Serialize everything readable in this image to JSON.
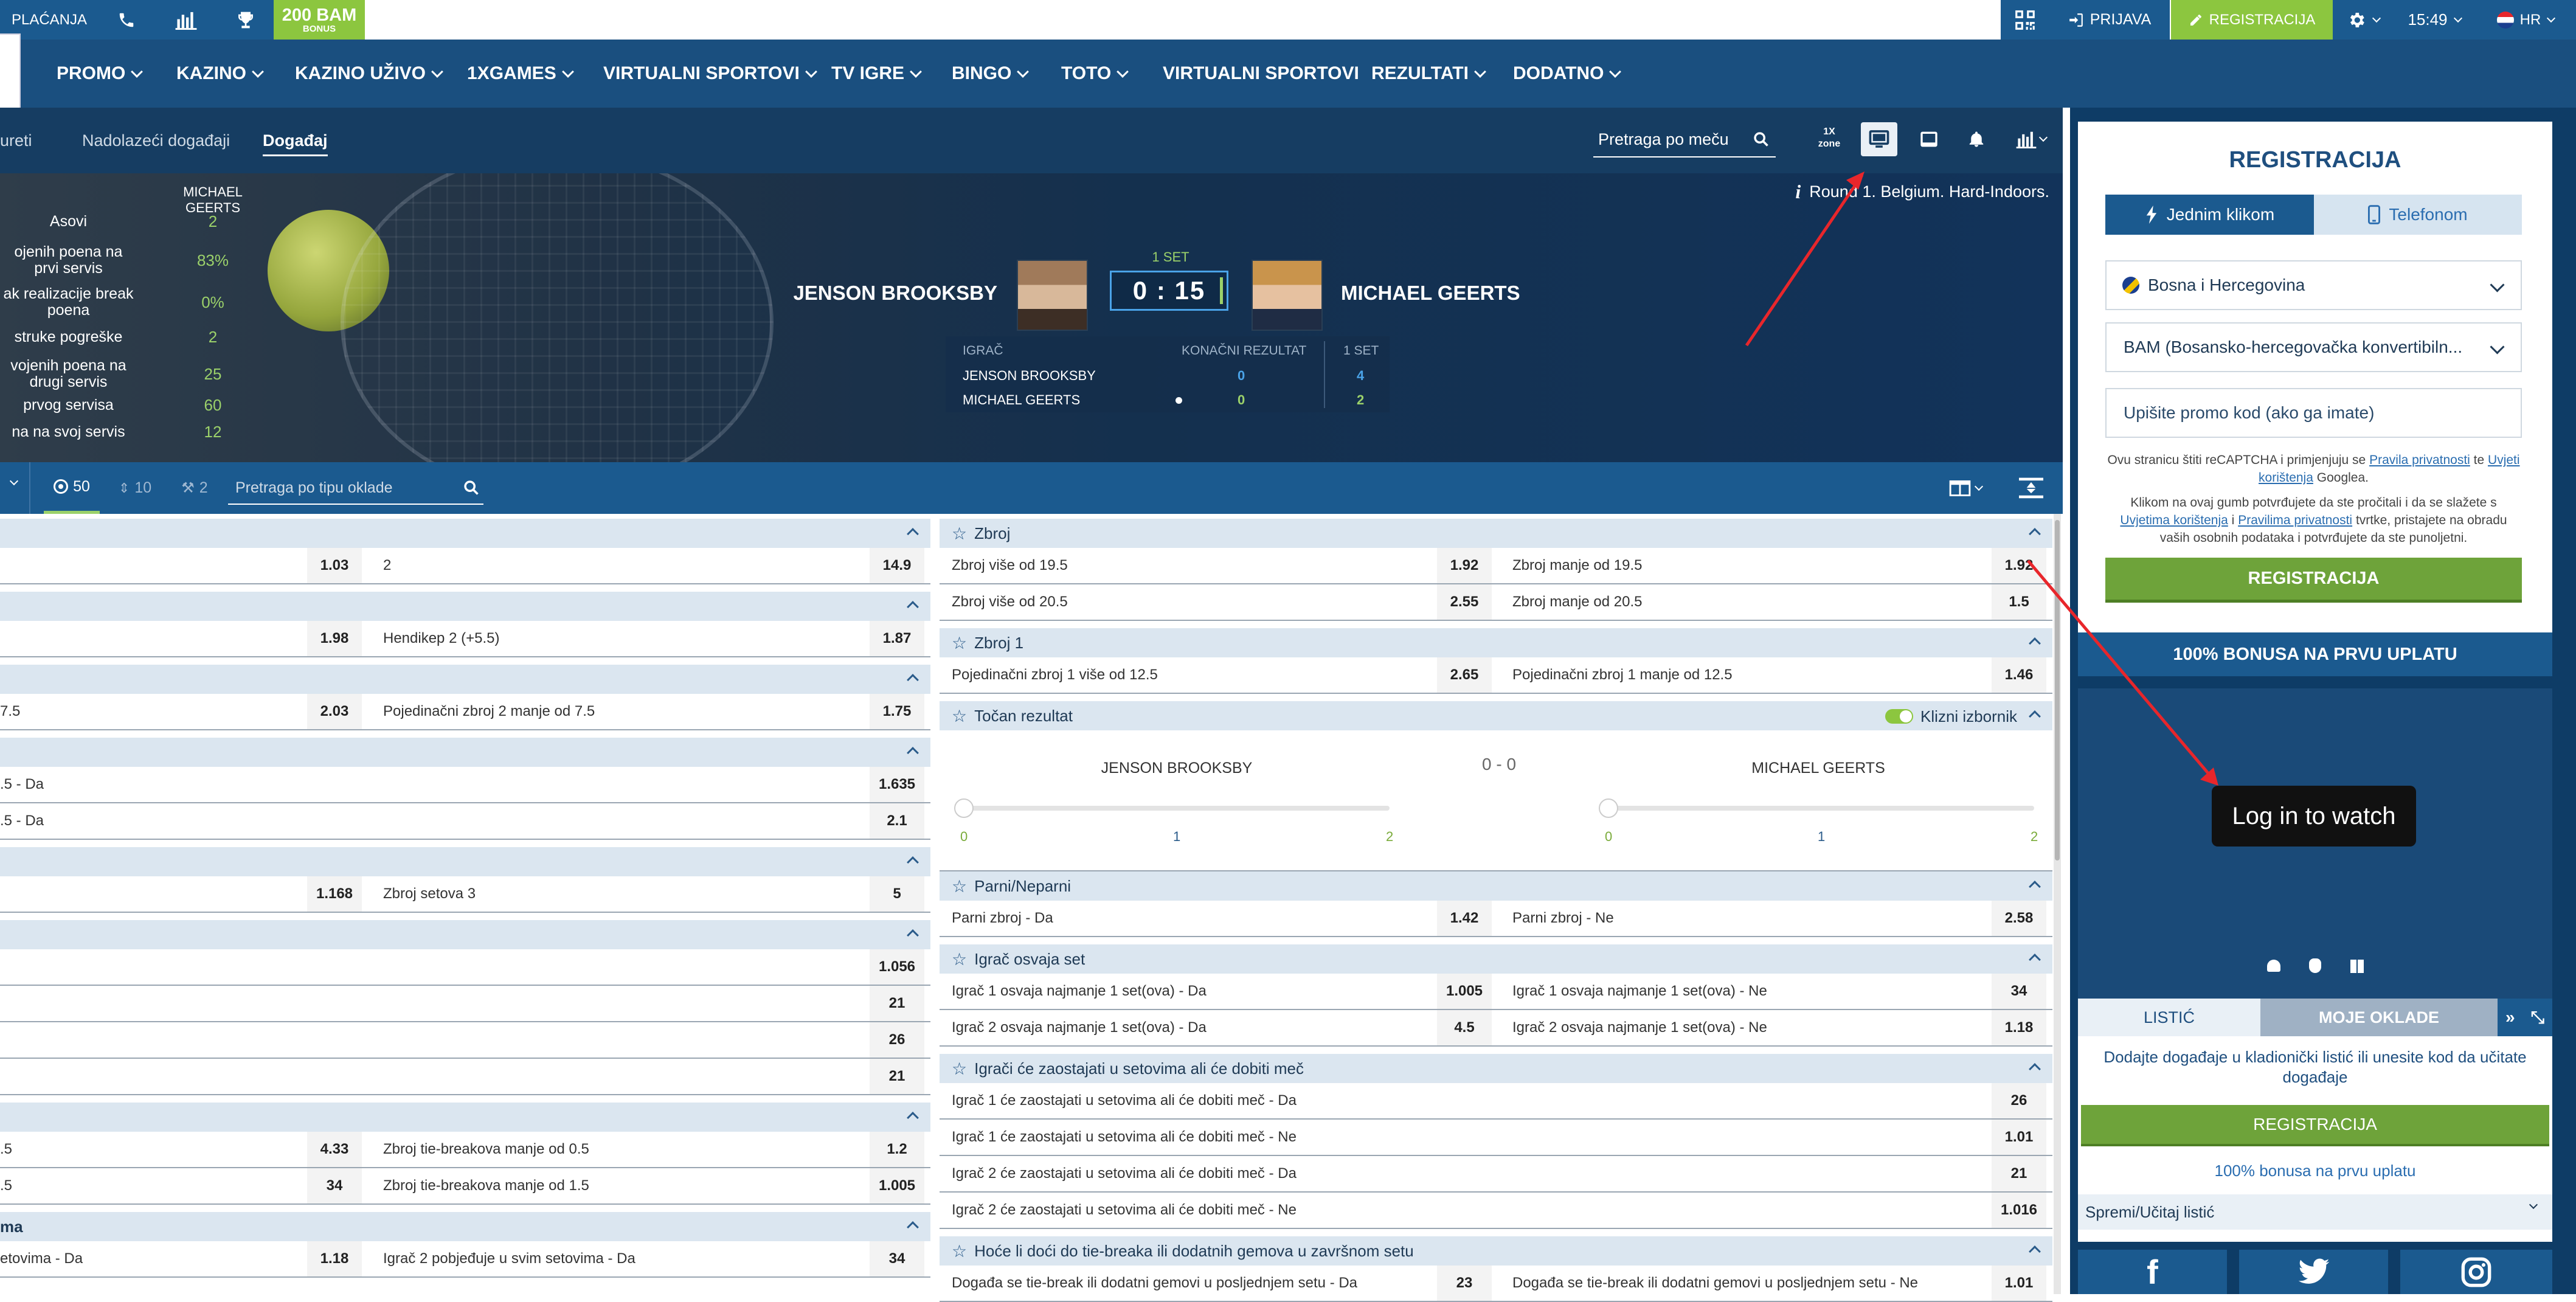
{
  "topbar": {
    "deposit_label": "PLAĆANJA",
    "bonus_amount": "200 BAM",
    "bonus_label": "BONUS",
    "login_label": "PRIJAVA",
    "register_label": "REGISTRACIJA",
    "time": "15:49",
    "language": "HR"
  },
  "menu": {
    "items": [
      "PROMO",
      "KAZINO",
      "KAZINO UŽIVO",
      "1XGAMES",
      "VIRTUALNI SPORTOVI",
      "TV IGRE",
      "BINGO",
      "TOTO",
      "VIRTUALNI SPORTOVI",
      "REZULTATI",
      "DODATNO"
    ]
  },
  "subnav": {
    "tab_1": "ureti",
    "tab_2": "Nadolazeći događaji",
    "tab_3": "Događaj",
    "search_placeholder": "Pretraga po meču",
    "zone_label": "1X zone"
  },
  "event": {
    "info": "Round 1. Belgium. Hard-Indoors.",
    "stats_header": "MICHAEL GEERTS",
    "stats": [
      {
        "label": "Asovi",
        "value": "2"
      },
      {
        "label": "ojenih poena na prvi servis",
        "value": "83%"
      },
      {
        "label": "ak realizacije break poena",
        "value": "0%"
      },
      {
        "label": "struke pogreške",
        "value": "2"
      },
      {
        "label": "vojenih poena na drugi servis",
        "value": "25"
      },
      {
        "label": "prvog servisa",
        "value": "60"
      },
      {
        "label": "na na svoj servis",
        "value": "12"
      }
    ],
    "player1": "JENSON BROOKSBY",
    "player2": "MICHAEL GEERTS",
    "set_label": "1 SET",
    "score": "0 : 15",
    "table_headers": {
      "player": "IGRAČ",
      "final": "KONAČNI REZULTAT",
      "set": "1 SET"
    },
    "table_rows": [
      {
        "name": "JENSON BROOKSBY",
        "final": "0",
        "set": "4"
      },
      {
        "name": "MICHAEL GEERTS",
        "final": "0",
        "set": "2"
      }
    ]
  },
  "toolbar": {
    "count_all": "50",
    "count_2": "10",
    "count_3": "2",
    "search_placeholder": "Pretraga po tipu oklade"
  },
  "left_markets": {
    "r1_odd1": "1.03",
    "r1_label2": "2",
    "r1_odd2": "14.9",
    "r2_odd1": "1.98",
    "r2_label2": "Hendikep 2 (+5.5)",
    "r2_odd2": "1.87",
    "r3_label1": "7.5",
    "r3_odd1": "2.03",
    "r3_label2": "Pojedinačni zbroj 2 manje od 7.5",
    "r3_odd2": "1.75",
    "r4_label1": ".5 - Da",
    "r4_odd": "1.635",
    "r5_label1": ".5 - Da",
    "r5_odd": "2.1",
    "r6_odd1": "1.168",
    "r6_label2": "Zbroj setova 3",
    "r6_odd2": "5",
    "r7_odd": "1.056",
    "r8_odd": "21",
    "r9_odd": "26",
    "r10_odd": "21",
    "r11_label1": ".5",
    "r11_odd1": "4.33",
    "r11_label2": "Zbroj tie-breakova manje od 0.5",
    "r11_odd2": "1.2",
    "r12_label1": ".5",
    "r12_odd1": "34",
    "r12_label2": "Zbroj tie-breakova manje od 1.5",
    "r12_odd2": "1.005",
    "sec_ma": "ma",
    "r13_label1": "etovima - Da",
    "r13_odd1": "1.18",
    "r13_label2": "Igrač 2 pobjeđuje u svim setovima - Da",
    "r13_odd2": "34"
  },
  "right_markets": {
    "zbroj": {
      "title": "Zbroj",
      "rows": [
        {
          "l1": "Zbroj više od 19.5",
          "o1": "1.92",
          "l2": "Zbroj manje od 19.5",
          "o2": "1.92"
        },
        {
          "l1": "Zbroj više od 20.5",
          "o1": "2.55",
          "l2": "Zbroj manje od 20.5",
          "o2": "1.5"
        }
      ]
    },
    "zbroj1": {
      "title": "Zbroj 1",
      "rows": [
        {
          "l1": "Pojedinačni zbroj 1 više od 12.5",
          "o1": "2.65",
          "l2": "Pojedinačni zbroj 1 manje od 12.5",
          "o2": "1.46"
        }
      ]
    },
    "tocan": {
      "title": "Točan rezultat",
      "toggle_label": "Klizni izbornik",
      "p1": "JENSON BROOKSBY",
      "p2": "MICHAEL GEERTS",
      "score": "0 - 0",
      "ticks": [
        "0",
        "1",
        "2"
      ]
    },
    "parni": {
      "title": "Parni/Neparni",
      "rows": [
        {
          "l1": "Parni zbroj - Da",
          "o1": "1.42",
          "l2": "Parni zbroj - Ne",
          "o2": "2.58"
        }
      ]
    },
    "osvaja": {
      "title": "Igrač osvaja set",
      "rows": [
        {
          "l1": "Igrač 1 osvaja najmanje 1 set(ova) - Da",
          "o1": "1.005",
          "l2": "Igrač 1 osvaja najmanje 1 set(ova) - Ne",
          "o2": "34"
        },
        {
          "l1": "Igrač 2 osvaja najmanje 1 set(ova) - Da",
          "o1": "4.5",
          "l2": "Igrač 2 osvaja najmanje 1 set(ova) - Ne",
          "o2": "1.18"
        }
      ]
    },
    "zaostajati": {
      "title": "Igrači će zaostajati u setovima ali će dobiti meč",
      "rows": [
        {
          "l1": "Igrač 1 će zaostajati u setovima ali će dobiti meč - Da",
          "o": "26"
        },
        {
          "l1": "Igrač 1 će zaostajati u setovima ali će dobiti meč - Ne",
          "o": "1.01"
        },
        {
          "l1": "Igrač 2 će zaostajati u setovima ali će dobiti meč - Da",
          "o": "21"
        },
        {
          "l1": "Igrač 2 će zaostajati u setovima ali će dobiti meč - Ne",
          "o": "1.016"
        }
      ]
    },
    "tiebreak": {
      "title": "Hoće li doći do tie-breaka ili dodatnih gemova u završnom setu",
      "rows": [
        {
          "l1": "Događa se tie-break ili dodatni gemovi u posljednjem setu - Da",
          "o1": "23",
          "l2": "Događa se tie-break ili dodatni gemovi u posljednjem setu - Ne",
          "o2": "1.01"
        }
      ]
    }
  },
  "registration": {
    "title": "REGISTRACIJA",
    "tab_one_click": "Jednim klikom",
    "tab_phone": "Telefonom",
    "country": "Bosna i Hercegovina",
    "currency": "BAM (Bosansko-hercegovačka konvertibiln...",
    "promo_placeholder": "Upišite promo kod (ako ga imate)",
    "recaptcha_1": "Ovu stranicu štiti reCAPTCHA i primjenjuju se",
    "recaptcha_link1": "Pravila privatnosti",
    "recaptcha_and": "te",
    "recaptcha_link2": "Uvjeti korištenja",
    "recaptcha_end": "Googlea.",
    "terms_1": "Klikom na ovaj gumb potvrđujete da ste pročitali i da se slažete s",
    "terms_link1": "Uvjetima korištenja",
    "terms_i": "i",
    "terms_link2": "Pravilima privatnosti",
    "terms_end": "tvrtke, pristajete na obradu vaših osobnih podataka i potvrđujete da ste punoljetni.",
    "button": "REGISTRACIJA",
    "bonus_banner": "100% BONUSA NA PRVU UPLATU"
  },
  "video": {
    "login_tooltip": "Log in to watch"
  },
  "betslip": {
    "tab_1": "LISTIĆ",
    "tab_2": "MOJE OKLADE",
    "info": "Dodajte događaje u kladionički listić ili unesite kod da učitate događaje",
    "button": "REGISTRACIJA",
    "bonus_link": "100% bonusa na prvu uplatu",
    "save_load": "Spremi/Učitaj listić"
  },
  "colors": {
    "brand_blue": "#1a4f7f",
    "dark_blue": "#163d62",
    "accent_green": "#8cc63f",
    "odds_green": "#9bd16a",
    "annotation_red": "#e8262b"
  }
}
